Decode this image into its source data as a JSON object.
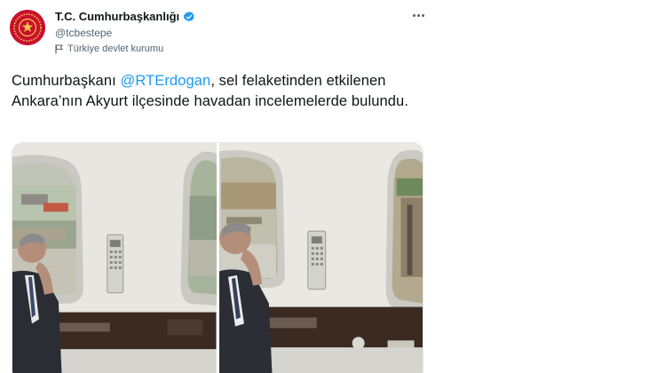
{
  "account": {
    "display_name": "T.C. Cumhurbaşkanlığı",
    "handle": "@tcbestepe",
    "affiliation": "Türkiye devlet kurumu",
    "avatar_icon": "presidential-seal-icon",
    "verified_icon": "verified-badge-icon",
    "affiliation_icon": "flag-icon"
  },
  "menu": {
    "more_icon": "more-options-icon"
  },
  "tweet": {
    "text_before": "Cumhurbaşkanı ",
    "mention": "@RTErdogan",
    "text_after": ", sel felaketinden etkilenen Ankara’nın Akyurt ilçesinde havadan incelemelerde bulundu."
  },
  "media": {
    "photo_count": 2,
    "photos": [
      {
        "subject": "photo-1"
      },
      {
        "subject": "photo-2"
      }
    ]
  },
  "colors": {
    "text": "#0f1419",
    "secondary": "#536471",
    "accent": "#1d9bf0",
    "avatar_bg": "#c8102e"
  }
}
